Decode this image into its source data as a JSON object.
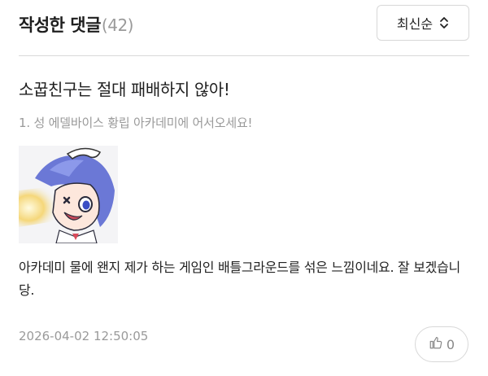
{
  "header": {
    "title": "작성한 댓글",
    "count": "(42)",
    "sort_label": "최신순",
    "sort_icon": "chevron-updown-icon"
  },
  "comment": {
    "post_title": "소꿉친구는 절대 패배하지 않아!",
    "post_subtitle": "1. 성 에델바이스 황립 아카데미에 어서오세요!",
    "sticker_name": "anime-character-sticker",
    "body": "아카데미 물에 왠지 제가 하는 게임인 배틀그라운드를 섞은 느낌이네요. 잘 보겠습니당.",
    "timestamp": "2026-04-02 12:50:05",
    "like_icon": "thumbs-up-icon",
    "like_count": "0"
  },
  "colors": {
    "text": "#222222",
    "muted": "#9a9a9a",
    "border": "#d8d8d8"
  }
}
